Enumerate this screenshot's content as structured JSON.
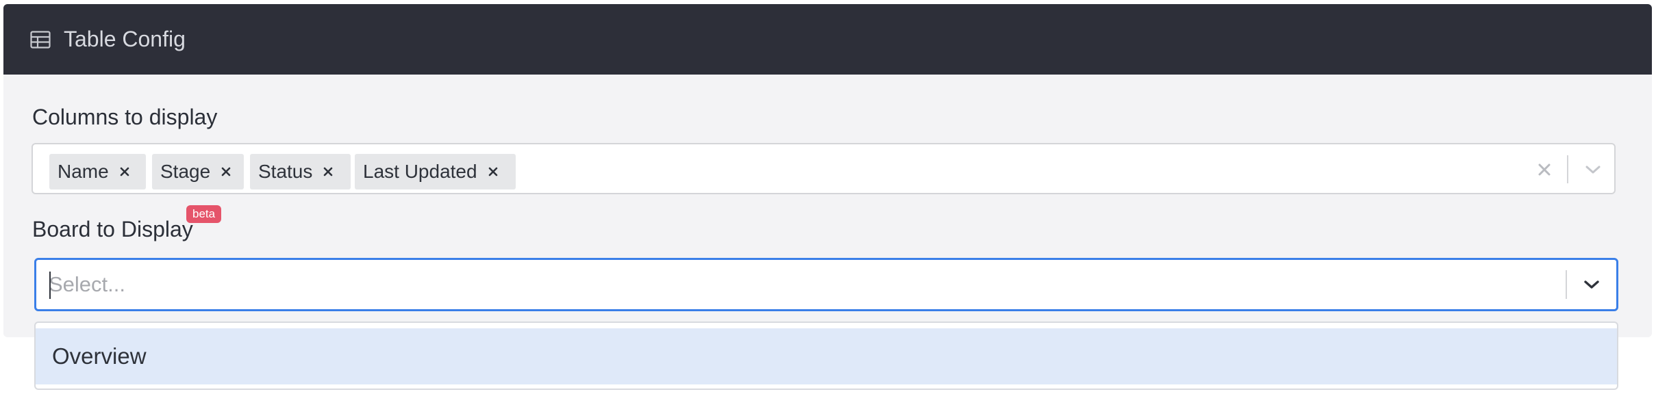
{
  "header": {
    "title": "Table Config",
    "icon": "table-icon"
  },
  "columns_field": {
    "label": "Columns to display",
    "selected": [
      {
        "label": "Name"
      },
      {
        "label": "Stage"
      },
      {
        "label": "Status"
      },
      {
        "label": "Last Updated"
      }
    ],
    "clear_icon": "close-icon",
    "dropdown_icon": "chevron-down-icon"
  },
  "board_field": {
    "label": "Board to Display",
    "badge": "beta",
    "placeholder": "Select...",
    "value": "",
    "dropdown_icon": "chevron-down-icon",
    "options": [
      {
        "label": "Overview",
        "focused": true
      }
    ]
  },
  "colors": {
    "header_bg": "#2d2f39",
    "panel_bg": "#f3f3f5",
    "focus_border": "#3a7fe8",
    "badge_bg": "#e5546a",
    "option_focus_bg": "#dfe9f9"
  }
}
